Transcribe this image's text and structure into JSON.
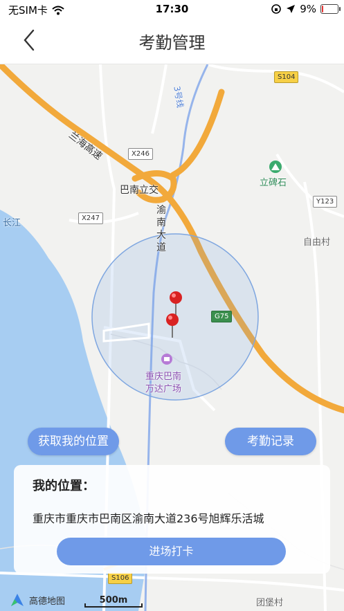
{
  "status_bar": {
    "carrier": "无SIM卡",
    "time": "17:30",
    "battery_percent": "9%",
    "battery_level": 0.09,
    "battery_color": "#e33333"
  },
  "nav": {
    "title": "考勤管理",
    "back_icon": "chevron-left-icon"
  },
  "map": {
    "labels": {
      "lanhai": "兰海高速",
      "x246": "X246",
      "banan_interchange": "巴南立交",
      "line3": "3号线",
      "s104": "S104",
      "libeishi": "立碑石",
      "y123": "Y123",
      "ziyoucun": "自由村",
      "changjiang": "长江",
      "x247": "X247",
      "yunan_avenue": "渝南大道",
      "g75": "G75",
      "wanda_line1": "重庆巴南",
      "wanda_line2": "万达广场",
      "s106": "S106",
      "tuanbaocun": "团堡村"
    },
    "colors": {
      "highway": "#f2a93b",
      "river": "#a7cdf2",
      "geofence_fill": "rgba(110,160,230,0.18)",
      "geofence_stroke": "#7ea6e0",
      "pin": "#d92222"
    },
    "footer": {
      "brand": "高德地图",
      "scale": "500m"
    }
  },
  "actions": {
    "get_location": "获取我的位置",
    "attendance_records": "考勤记录"
  },
  "location_card": {
    "title": "我的位置：",
    "address": "重庆市重庆市巴南区渝南大道236号旭辉乐活城",
    "checkin": "进场打卡"
  }
}
